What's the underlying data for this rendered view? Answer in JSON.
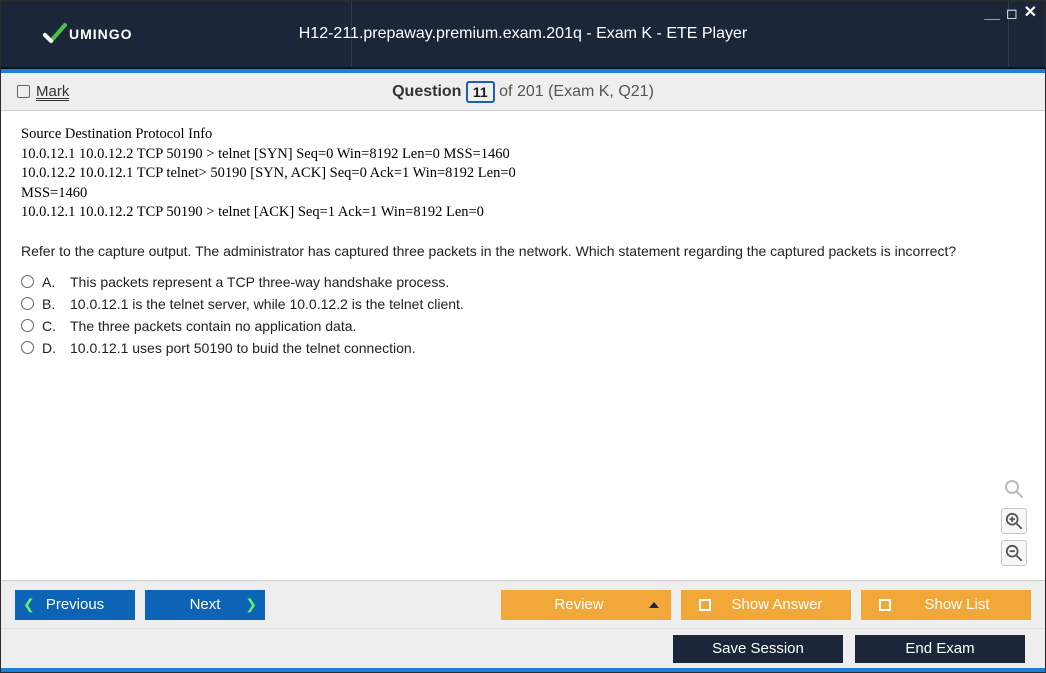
{
  "window": {
    "title": "H12-211.prepaway.premium.exam.201q - Exam K - ETE Player",
    "brand": "UMINGO"
  },
  "header": {
    "mark_label": "Mark",
    "question_word": "Question",
    "question_number": "11",
    "of_text": " of 201 (Exam K, Q21)"
  },
  "question": {
    "preformatted": [
      "Source Destination Protocol Info",
      "10.0.12.1 10.0.12.2 TCP 50190 > telnet [SYN] Seq=0 Win=8192 Len=0 MSS=1460",
      "10.0.12.2 10.0.12.1 TCP telnet> 50190 [SYN, ACK] Seq=0 Ack=1 Win=8192 Len=0",
      "MSS=1460",
      "10.0.12.1 10.0.12.2 TCP 50190 > telnet [ACK] Seq=1 Ack=1 Win=8192 Len=0"
    ],
    "prompt": "Refer to the capture output. The administrator has captured three packets in the network. Which statement regarding the captured packets is incorrect?",
    "options": [
      {
        "letter": "A.",
        "text": "This packets represent a TCP three-way handshake process."
      },
      {
        "letter": "B.",
        "text": "10.0.12.1 is the telnet server, while 10.0.12.2 is the telnet client."
      },
      {
        "letter": "C.",
        "text": "The three packets contain no application data."
      },
      {
        "letter": "D.",
        "text": "10.0.12.1 uses port 50190 to buid the telnet connection."
      }
    ]
  },
  "footer": {
    "previous": "Previous",
    "next": "Next",
    "review": "Review",
    "show_answer": "Show Answer",
    "show_list": "Show List",
    "save_session": "Save Session",
    "end_exam": "End Exam"
  }
}
